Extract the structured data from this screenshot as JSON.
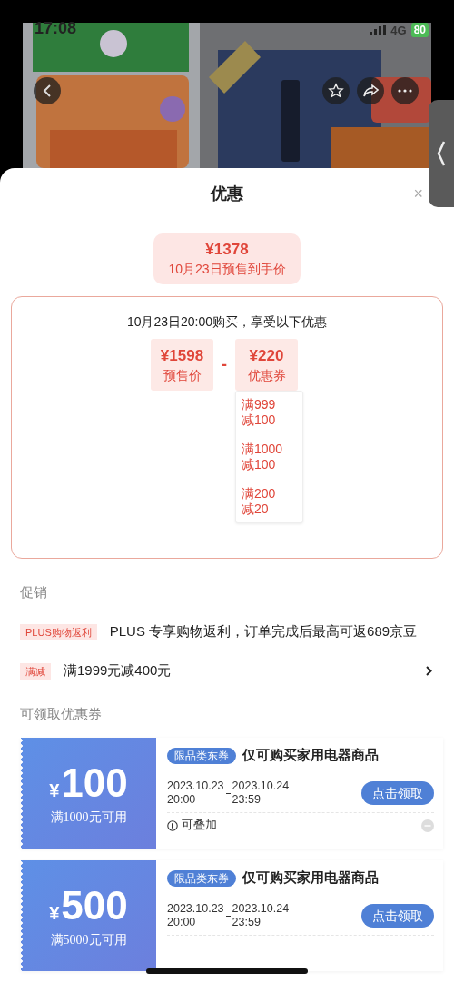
{
  "status_bar": {
    "time": "17:08",
    "network": "4G",
    "battery": "80"
  },
  "sheet": {
    "title": "优惠",
    "close": "×"
  },
  "final_price": {
    "price": "¥1378",
    "label": "10月23日预售到手价"
  },
  "breakdown": {
    "heading": "10月23日20:00购买，享受以下优惠",
    "presale": {
      "price": "¥1598",
      "label": "预售价"
    },
    "operator": "-",
    "coupon": {
      "price": "¥220",
      "label": "优惠券"
    },
    "coupon_items": [
      {
        "threshold": "满999",
        "discount": "减100"
      },
      {
        "threshold": "满1000",
        "discount": "减100"
      },
      {
        "threshold": "满200",
        "discount": "减20"
      }
    ]
  },
  "promotions": {
    "heading": "促销",
    "items": [
      {
        "tag": "PLUS购物返利",
        "text": "PLUS 专享购物返利，订单完成后最高可返689京豆",
        "has_arrow": false
      },
      {
        "tag": "满减",
        "text": "满1999元减400元",
        "has_arrow": true
      }
    ]
  },
  "coupons": {
    "heading": "可领取优惠券",
    "items": [
      {
        "currency": "¥",
        "amount": "100",
        "condition": "满1000元可用",
        "tag": "限品类东券",
        "title": "仅可购买家用电器商品",
        "start_date": "2023.10.23",
        "start_time": "20:00",
        "end_date": "2023.10.24",
        "end_time": "23:59",
        "button": "点击领取",
        "stackable": "可叠加"
      },
      {
        "currency": "¥",
        "amount": "500",
        "condition": "满5000元可用",
        "tag": "限品类东券",
        "title": "仅可购买家用电器商品",
        "start_date": "2023.10.23",
        "start_time": "20:00",
        "end_date": "2023.10.24",
        "end_time": "23:59",
        "button": "点击领取"
      }
    ]
  }
}
